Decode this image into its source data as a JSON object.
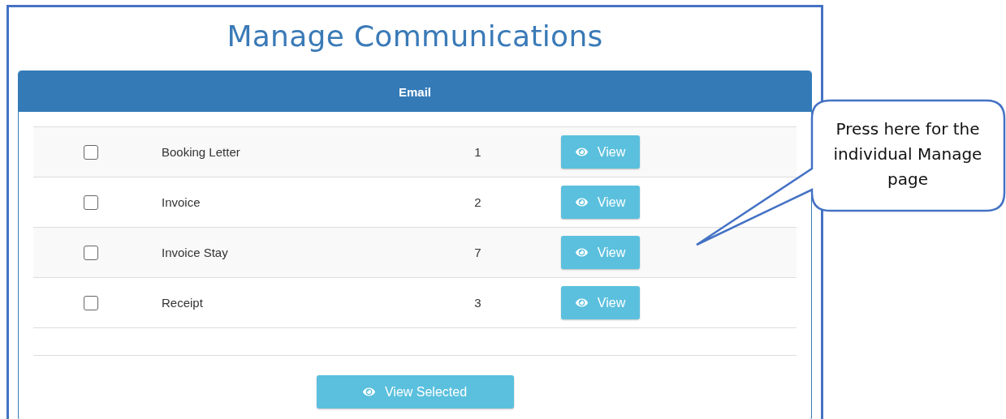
{
  "title": "Manage Communications",
  "panel": {
    "header": "Email",
    "rows": [
      {
        "checked": false,
        "name": "Booking Letter",
        "count": "1",
        "button": "View"
      },
      {
        "checked": false,
        "name": "Invoice",
        "count": "2",
        "button": "View"
      },
      {
        "checked": false,
        "name": "Invoice Stay",
        "count": "7",
        "button": "View"
      },
      {
        "checked": false,
        "name": "Receipt",
        "count": "3",
        "button": "View"
      }
    ],
    "footer_button": "View Selected"
  },
  "callout": {
    "text": "Press here for the individual Manage page"
  }
}
